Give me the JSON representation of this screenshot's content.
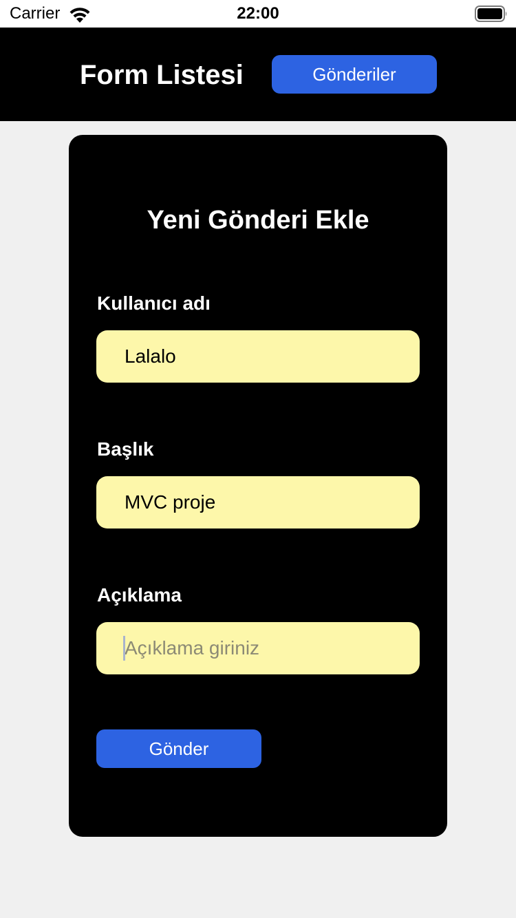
{
  "status_bar": {
    "carrier": "Carrier",
    "time": "22:00",
    "wifi_icon": "wifi-icon",
    "battery_icon": "battery-icon"
  },
  "nav": {
    "title": "Form Listesi",
    "posts_button": "Gönderiler"
  },
  "form": {
    "title": "Yeni Gönderi Ekle",
    "username": {
      "label": "Kullanıcı adı",
      "value": "Lalalo"
    },
    "post_title": {
      "label": "Başlık",
      "value": "MVC proje"
    },
    "description": {
      "label": "Açıklama",
      "value": "",
      "placeholder": "Açıklama giriniz"
    },
    "submit_button": "Gönder"
  },
  "colors": {
    "accent": "#2d63e2",
    "input_background": "#fdf7aa",
    "header_background": "#000000",
    "page_background": "#f0f0f0"
  }
}
